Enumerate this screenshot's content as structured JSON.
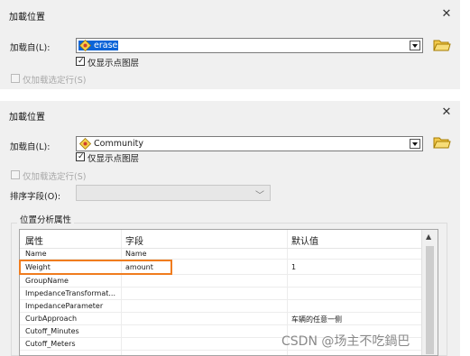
{
  "dialog1": {
    "title": "加載位置",
    "load_from_label": "加载自(L):",
    "load_from_value": "erase",
    "only_points_label": "仅显示点图层",
    "only_selected_label": "仅加载选定行(S)"
  },
  "dialog2": {
    "title": "加載位置",
    "load_from_label": "加载自(L):",
    "load_from_value": "Community",
    "only_points_label": "仅显示点图层",
    "only_selected_label": "仅加载选定行(S)",
    "sort_field_label": "排序字段(O):",
    "group_title": "位置分析属性",
    "columns": [
      "属性",
      "字段",
      "默认值"
    ],
    "rows": [
      {
        "attr": "Name",
        "field": "Name",
        "default": ""
      },
      {
        "attr": "Weight",
        "field": "amount",
        "default": "1"
      },
      {
        "attr": "GroupName",
        "field": "",
        "default": ""
      },
      {
        "attr": "ImpedanceTransformat...",
        "field": "",
        "default": ""
      },
      {
        "attr": "ImpedanceParameter",
        "field": "",
        "default": ""
      },
      {
        "attr": "CurbApproach",
        "field": "",
        "default": "车辆的任意一侧"
      },
      {
        "attr": "Cutoff_Minutes",
        "field": "",
        "default": ""
      },
      {
        "attr": "Cutoff_Meters",
        "field": "",
        "default": ""
      }
    ]
  },
  "watermark": "CSDN @场主不吃鍋巴",
  "icons": {
    "close": "close-icon",
    "layer": "layer-icon",
    "folder": "open-folder-icon",
    "dropdown": "chevron-down-icon",
    "scroll_up": "scroll-up-icon"
  },
  "colors": {
    "selection": "#0a64d8",
    "highlight_box": "#f07c1e",
    "folder": "#f2c94c"
  }
}
